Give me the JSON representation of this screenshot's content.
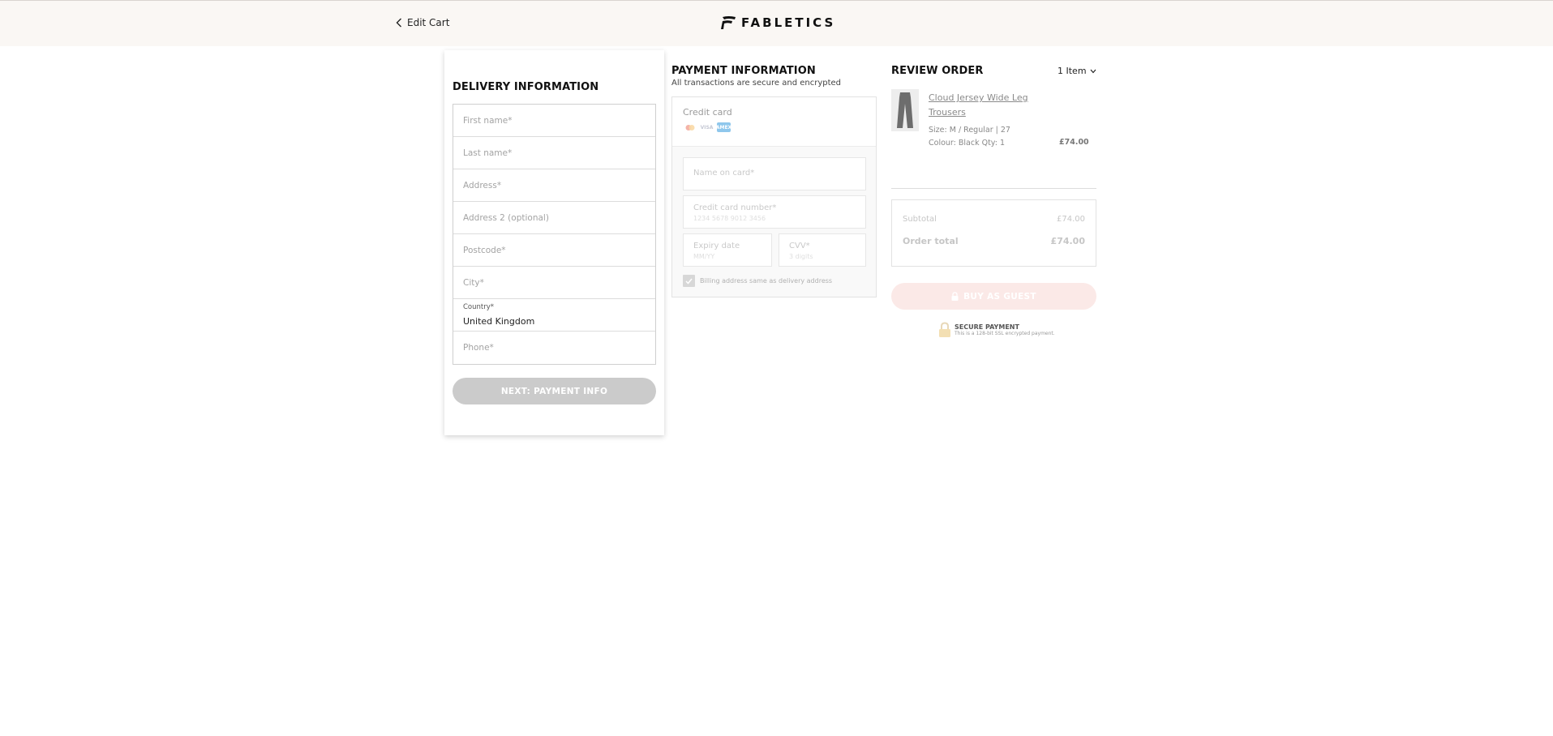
{
  "header": {
    "back_label": "Edit Cart",
    "brand": "FABLETICS"
  },
  "delivery": {
    "title": "DELIVERY INFORMATION",
    "fields": {
      "first_name": "First name*",
      "last_name": "Last name*",
      "address": "Address*",
      "address2": "Address 2 (optional)",
      "postcode": "Postcode*",
      "city": "City*",
      "country_label": "Country*",
      "country_value": "United Kingdom",
      "phone": "Phone*"
    },
    "next_button": "NEXT:  PAYMENT INFO"
  },
  "payment": {
    "title": "PAYMENT INFORMATION",
    "subtitle": "All transactions are secure and encrypted",
    "credit_card_label": "Credit card",
    "card_brands": [
      "mastercard-icon",
      "visa-icon",
      "amex-icon"
    ],
    "card_icon_text": {
      "visa": "VISA",
      "amex": "AMEX"
    },
    "name_on_card": "Name on card*",
    "card_number_label": "Credit card number*",
    "card_number_placeholder": "1234 5678 9012 3456",
    "expiry_label": "Expiry date",
    "expiry_placeholder": "MM/YY",
    "cvv_label": "CVV*",
    "cvv_placeholder": "3 digits",
    "billing_same": "Billing address same as delivery address"
  },
  "review": {
    "title": "REVIEW ORDER",
    "items_count": "1 Item",
    "product": {
      "name": "Cloud Jersey Wide Leg Trousers",
      "size": "Size: M / Regular | 27",
      "colour_qty": "Colour: Black  Qty: 1",
      "price": "£74.00"
    },
    "subtotal_label": "Subtotal",
    "subtotal_value": "£74.00",
    "total_label": "Order total",
    "total_value": "£74.00",
    "buy_button": "BUY AS GUEST",
    "secure_title": "SECURE PAYMENT",
    "secure_desc": "This is a 128-bit SSL encrypted payment."
  },
  "colors": {
    "topbar_bg": "#faf7f4",
    "disabled_button": "#cbcbcb",
    "buy_button_disabled": "#fbe9e7",
    "amex_blue": "#8fc7ec"
  }
}
